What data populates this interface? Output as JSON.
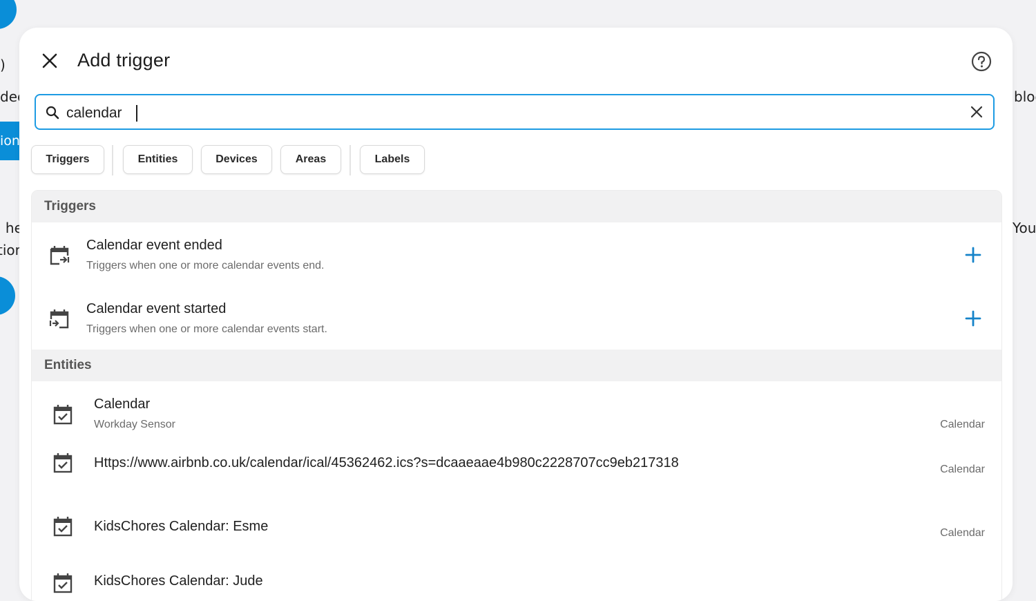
{
  "background": {
    "fragments": [
      ")",
      "dec",
      "ion",
      "l he",
      "tion",
      "bloc",
      "You"
    ]
  },
  "dialog": {
    "title": "Add trigger",
    "icons": {
      "close": "close-icon",
      "help": "help-circle-icon"
    }
  },
  "search": {
    "value": "calendar",
    "placeholder": "",
    "icons": {
      "search": "search-icon",
      "clear": "clear-icon"
    }
  },
  "filters": [
    {
      "label": "Triggers"
    },
    {
      "label": "Entities"
    },
    {
      "label": "Devices"
    },
    {
      "label": "Areas"
    },
    {
      "label": "Labels"
    }
  ],
  "sections": {
    "triggers": {
      "header": "Triggers",
      "items": [
        {
          "title": "Calendar event ended",
          "subtitle": "Triggers when one or more calendar events end.",
          "icon": "calendar-end-icon"
        },
        {
          "title": "Calendar event started",
          "subtitle": "Triggers when one or more calendar events start.",
          "icon": "calendar-start-icon"
        }
      ]
    },
    "entities": {
      "header": "Entities",
      "items": [
        {
          "title": "Calendar",
          "subtitle": "Workday Sensor",
          "domain": "Calendar",
          "icon": "calendar-check-icon"
        },
        {
          "title": "Https://www.airbnb.co.uk/calendar/ical/45362462.ics?s=dcaaeaae4b980c2228707cc9eb217318",
          "domain": "Calendar",
          "icon": "calendar-check-icon"
        },
        {
          "title": "KidsChores Calendar: Esme",
          "domain": "Calendar",
          "icon": "calendar-check-icon"
        },
        {
          "title": "KidsChores Calendar: Jude",
          "domain": "",
          "icon": "calendar-check-icon"
        }
      ]
    }
  },
  "colors": {
    "accent": "#1d9be3",
    "add": "#1583c9",
    "brand_blue": "#0a8ed8"
  }
}
